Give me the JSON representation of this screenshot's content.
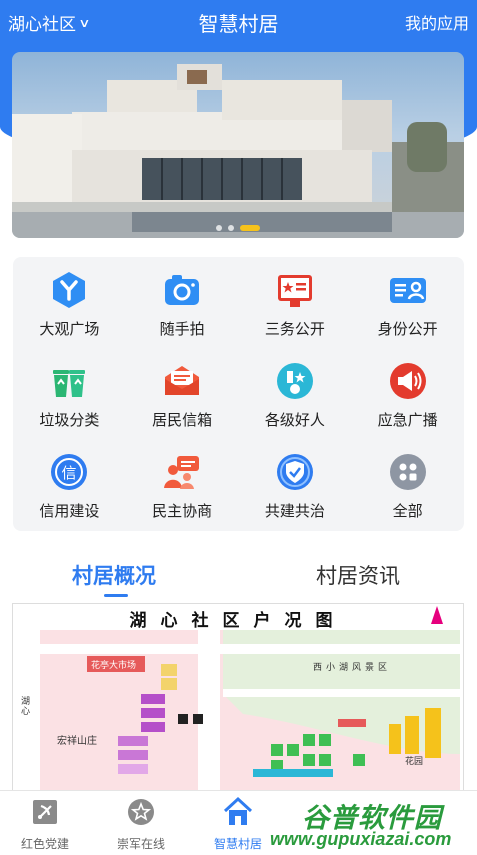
{
  "header": {
    "community": "湖心社区",
    "title": "智慧村居",
    "my_apps": "我的应用"
  },
  "banner": {
    "slides": 3,
    "active_slide": 2
  },
  "grid": [
    {
      "label": "大观广场",
      "icon": "grid-y-icon",
      "color": "#2f8ef4"
    },
    {
      "label": "随手拍",
      "icon": "camera-icon",
      "color": "#2f8ef4"
    },
    {
      "label": "三务公开",
      "icon": "notice-board-icon",
      "color": "#e33b2e"
    },
    {
      "label": "身份公开",
      "icon": "id-card-icon",
      "color": "#2f8ef4"
    },
    {
      "label": "垃圾分类",
      "icon": "trash-bins-icon",
      "color": "#2bb673"
    },
    {
      "label": "居民信箱",
      "icon": "mailbox-icon",
      "color": "#f15a3c"
    },
    {
      "label": "各级好人",
      "icon": "medal-icon",
      "color": "#2bb7d6"
    },
    {
      "label": "应急广播",
      "icon": "megaphone-icon",
      "color": "#e33b2e"
    },
    {
      "label": "信用建设",
      "icon": "credit-icon",
      "color": "#2f7cf0"
    },
    {
      "label": "民主协商",
      "icon": "discussion-icon",
      "color": "#f15a3c"
    },
    {
      "label": "共建共治",
      "icon": "shield-check-icon",
      "color": "#2f7cf0"
    },
    {
      "label": "全部",
      "icon": "all-apps-icon",
      "color": "#8e96a3"
    }
  ],
  "tabs": {
    "active": "村居概况",
    "inactive": "村居资讯"
  },
  "map": {
    "title": "湖心社区户况图",
    "labels": [
      "花亭大市场",
      "西小湖风景区",
      "宏祥山庄",
      "湖心",
      "花园"
    ]
  },
  "bottom_nav": [
    {
      "label": "红色党建",
      "icon": "party-icon"
    },
    {
      "label": "崇军在线",
      "icon": "star-icon"
    },
    {
      "label": "智慧村居",
      "icon": "home-icon",
      "active": true
    }
  ],
  "watermark": {
    "text": "谷普软件园",
    "url": "www.gupuxiazai.com"
  },
  "colors": {
    "primary": "#2f7cf0",
    "accent": "#f5c21b"
  }
}
